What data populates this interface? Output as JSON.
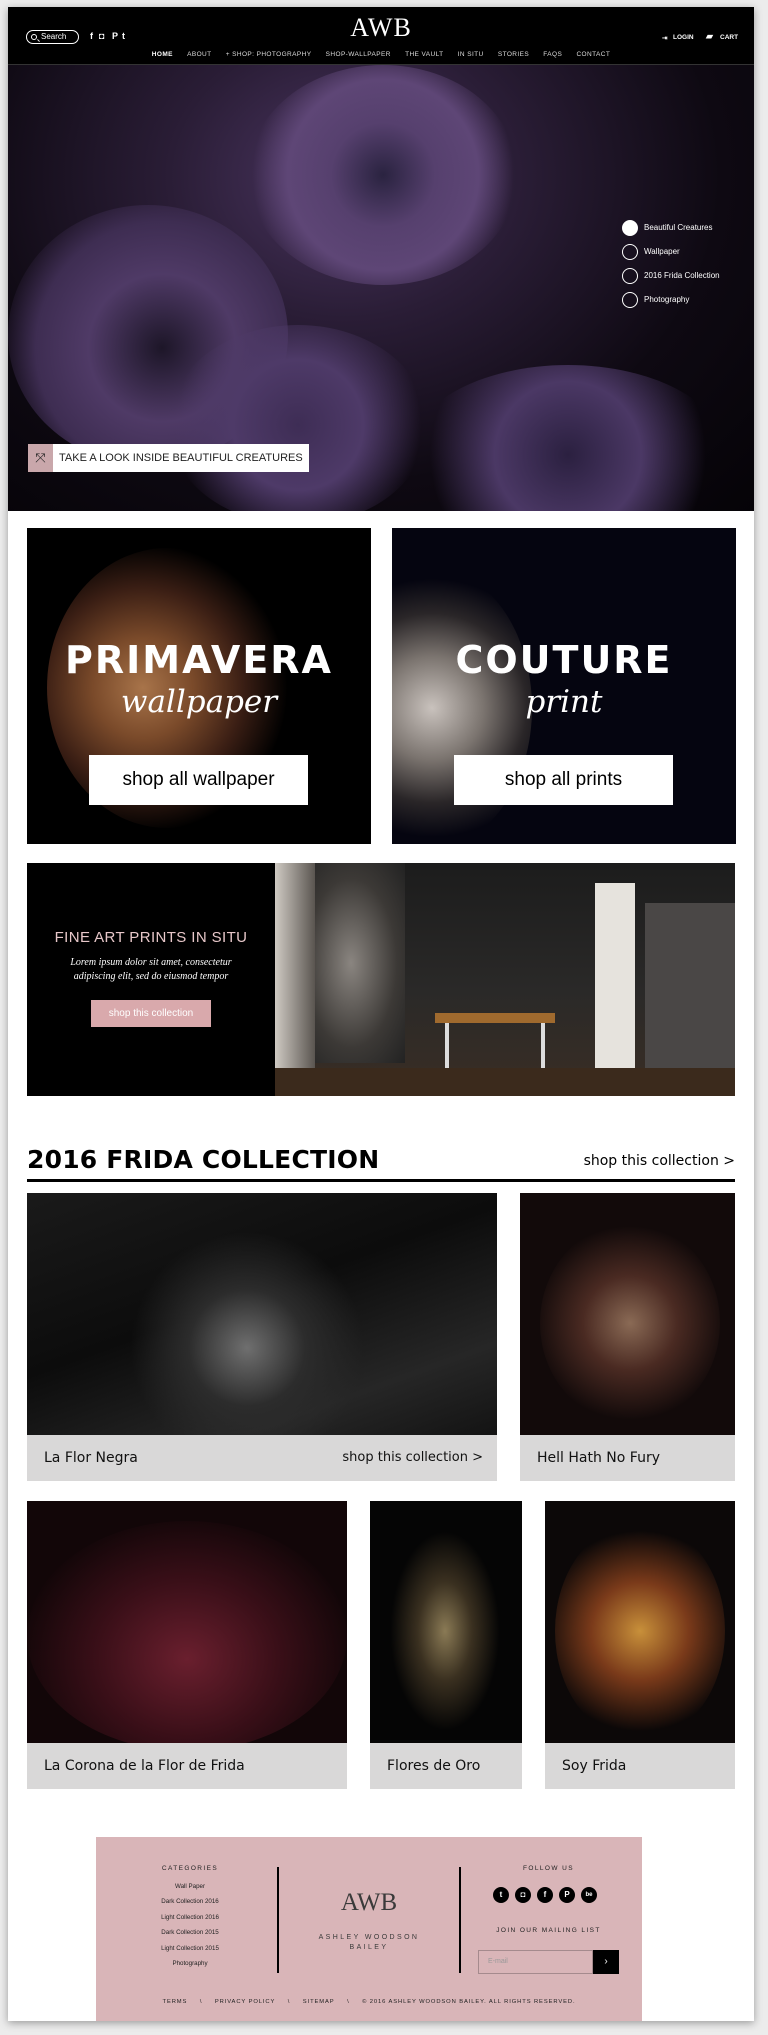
{
  "header": {
    "search_placeholder": "Search",
    "social": [
      "f",
      "◘",
      "P",
      "t"
    ],
    "logo": "AWB",
    "login": "LOGIN",
    "cart": "CART",
    "nav": [
      "HOME",
      "ABOUT",
      "+ SHOP: PHOTOGRAPHY",
      "SHOP-WALLPAPER",
      "THE VAULT",
      "IN SITU",
      "STORIES",
      "FAQS",
      "CONTACT"
    ]
  },
  "hero": {
    "options": [
      "Beautiful Creatures",
      "Wallpaper",
      "2016 Frida Collection",
      "Photography"
    ],
    "selected_index": 0,
    "cta": "TAKE A LOOK INSIDE BEAUTIFUL CREATURES"
  },
  "promos": [
    {
      "title": "PRIMAVERA",
      "subtitle": "wallpaper",
      "button": "shop all wallpaper"
    },
    {
      "title": "COUTURE",
      "subtitle": "print",
      "button": "shop all prints"
    }
  ],
  "insitu": {
    "heading": "FINE ART PRINTS IN SITU",
    "body": "Lorem ipsum dolor sit amet, consectetur adipiscing elit, sed do eiusmod tempor",
    "button": "shop this collection"
  },
  "frida": {
    "title": "2016 FRIDA COLLECTION",
    "link": "shop this collection >",
    "cards": [
      {
        "name": "La Flor Negra",
        "link": "shop this collection >"
      },
      {
        "name": "Hell Hath No Fury"
      },
      {
        "name": "La Corona de la Flor de Frida"
      },
      {
        "name": "Flores de Oro"
      },
      {
        "name": "Soy Frida"
      }
    ]
  },
  "footer": {
    "categories_title": "CATEGORIES",
    "categories": [
      "Wall Paper",
      "Dark Collection 2016",
      "Light Collection 2016",
      "Dark Collection 2015",
      "Light Collection 2015",
      "Photography"
    ],
    "logo": "AWB",
    "name_line1": "ASHLEY WOODSON",
    "name_line2": "BAILEY",
    "follow_title": "FOLLOW US",
    "social": [
      "t",
      "◘",
      "f",
      "P",
      "be"
    ],
    "mailing_title": "JOIN OUR MAILING LIST",
    "email_placeholder": "E-mail",
    "submit": "›",
    "bottom": [
      "TERMS",
      "\\",
      "PRIVACY POLICY",
      "\\",
      "SITEMAP",
      "\\",
      "© 2016 ASHLEY WOODSON BAILEY. ALL RIGHTS RESERVED."
    ]
  },
  "colors": {
    "accent_pink": "#d9b5b8",
    "button_pink": "#d9a9ac",
    "header_bg": "#000000"
  }
}
